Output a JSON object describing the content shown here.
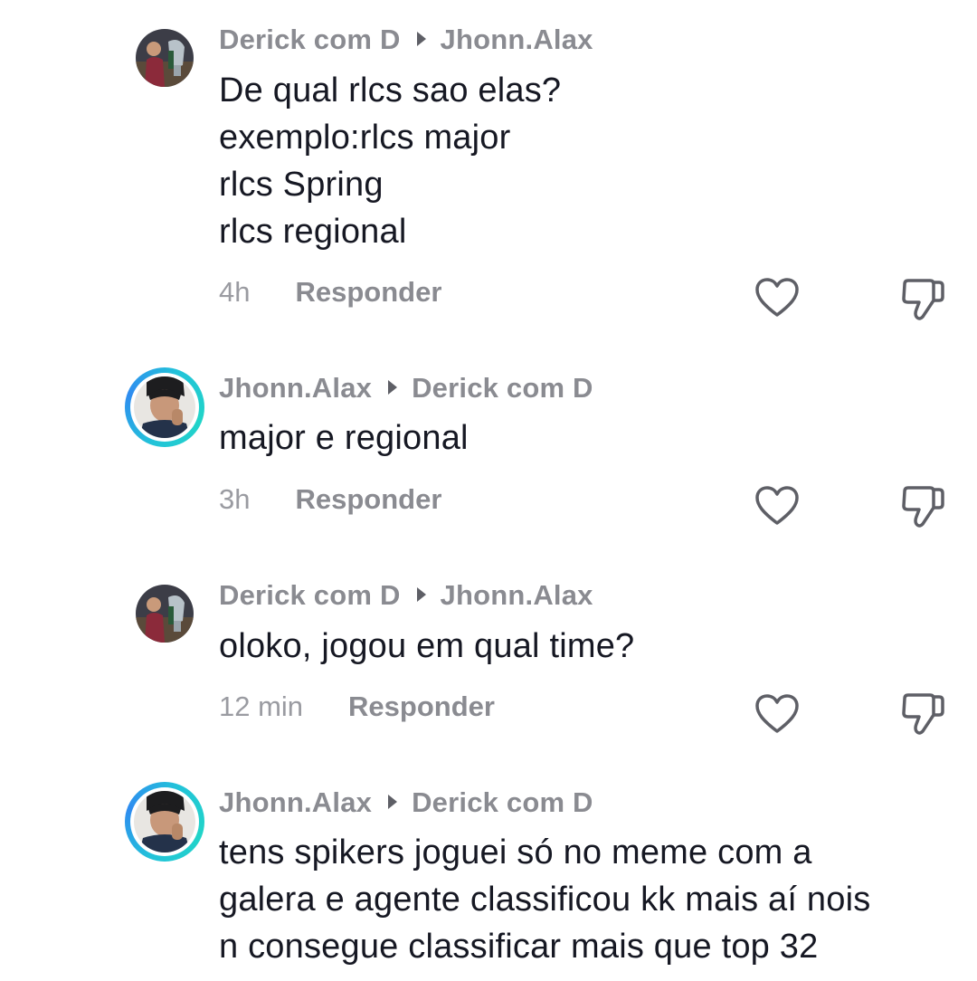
{
  "comments": [
    {
      "author": "Derick com D",
      "reply_to": "Jhonn.Alax",
      "lines": [
        "De qual rlcs sao elas?",
        "exemplo:rlcs major",
        "rlcs Spring",
        "rlcs regional"
      ],
      "time": "4h",
      "reply_label": "Responder",
      "avatar_icon": "profile-photo-soccer-player-trophy",
      "avatar_ring": false
    },
    {
      "author": "Jhonn.Alax",
      "reply_to": "Derick com D",
      "lines": [
        "major e regional"
      ],
      "time": "3h",
      "reply_label": "Responder",
      "avatar_icon": "profile-photo-person",
      "avatar_ring": true
    },
    {
      "author": "Derick com D",
      "reply_to": "Jhonn.Alax",
      "lines": [
        "oloko, jogou em qual time?"
      ],
      "time": "12 min",
      "reply_label": "Responder",
      "avatar_icon": "profile-photo-soccer-player-trophy",
      "avatar_ring": false
    },
    {
      "author": "Jhonn.Alax",
      "reply_to": "Derick com D",
      "lines": [
        "tens spikers joguei só no meme com a",
        "galera e agente classificou kk mais aí nois",
        "n consegue classificar mais que top 32"
      ],
      "avatar_icon": "profile-photo-person",
      "avatar_ring": true
    }
  ],
  "icons": {
    "like": "heart-outline-icon",
    "dislike": "thumbs-down-outline-icon",
    "reply_arrow": "triangle-right-icon"
  },
  "colors": {
    "text": "#161823",
    "muted": "#8a8b91",
    "ring_accent": "#22c3d9"
  }
}
